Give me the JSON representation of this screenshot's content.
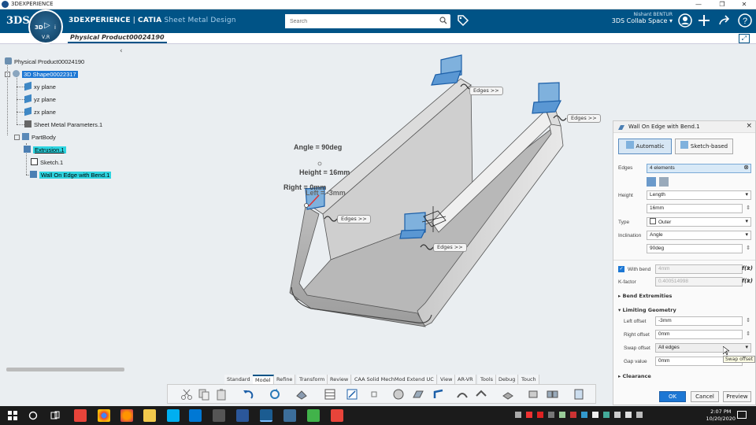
{
  "window": {
    "title": "3DEXPERIENCE",
    "controls": [
      "—",
      "❐",
      "✕"
    ]
  },
  "header": {
    "brand_main": "3DEXPERIENCE",
    "brand_sep": " | ",
    "brand_catia": "CATIA",
    "brand_app": "Sheet Metal Design",
    "compass_3d": "3D",
    "compass_v": "V,R",
    "search_placeholder": "Search",
    "user_name": "Nishant BENTUR",
    "collab_space": "3DS Collab Space"
  },
  "tab": {
    "label": "Physical Product00024190",
    "plus": "+"
  },
  "tree": {
    "root": "Physical Product00024190",
    "shape": "3D Shape00022317",
    "xy": "xy plane",
    "yz": "yz plane",
    "zx": "zx plane",
    "params": "Sheet Metal Parameters.1",
    "partbody": "PartBody",
    "extrusion": "Extrusion.1",
    "sketch": "Sketch.1",
    "wall": "Wall On Edge with Bend.1"
  },
  "viewport": {
    "angle": "Angle = 90deg",
    "height": "Height = 16mm",
    "right": "Right = 0mm",
    "left": "Left = -3mm",
    "edges1": "Edges >>",
    "edges2": "Edges >>",
    "edges3": "Edges >>",
    "edges4": "Edges >>"
  },
  "panel": {
    "title": "Wall On Edge with Bend.1",
    "mode_auto": "Automatic",
    "mode_sketch": "Sketch-based",
    "edges_label": "Edges",
    "edges_value": "4 elements",
    "height_label": "Height",
    "height_mode": "Length",
    "height_value": "16mm",
    "type_label": "Type",
    "type_value": "Outer",
    "inclination_label": "Inclination",
    "inclination_mode": "Angle",
    "inclination_value": "90deg",
    "with_bend_label": "With bend",
    "with_bend_value": "4mm",
    "kfactor_label": "K-factor",
    "kfactor_value": "0.400514998",
    "bend_ext": "Bend Extremities",
    "limiting": "Limiting Geometry",
    "left_offset_label": "Left offset",
    "left_offset_value": "-3mm",
    "right_offset_label": "Right offset",
    "right_offset_value": "0mm",
    "swap_label": "Swap offset",
    "swap_value": "All edges",
    "gap_label": "Gap value",
    "gap_value": "0mm",
    "clearance": "Clearance",
    "ok": "OK",
    "cancel": "Cancel",
    "preview": "Preview",
    "tooltip": "Swap offset",
    "fx": "f(x)"
  },
  "toolbar_tabs": [
    "Standard",
    "Model",
    "Refine",
    "Transform",
    "Review",
    "CAA Solid MechMod Extend UC",
    "View",
    "AR-VR",
    "Tools",
    "Debug",
    "Touch"
  ],
  "taskbar": {
    "time": "2:07 PM",
    "date": "10/20/2020"
  },
  "colors": {
    "topbar": "#005386",
    "highlight_blue": "#1c77d4",
    "highlight_cyan": "#2ed4e0"
  }
}
